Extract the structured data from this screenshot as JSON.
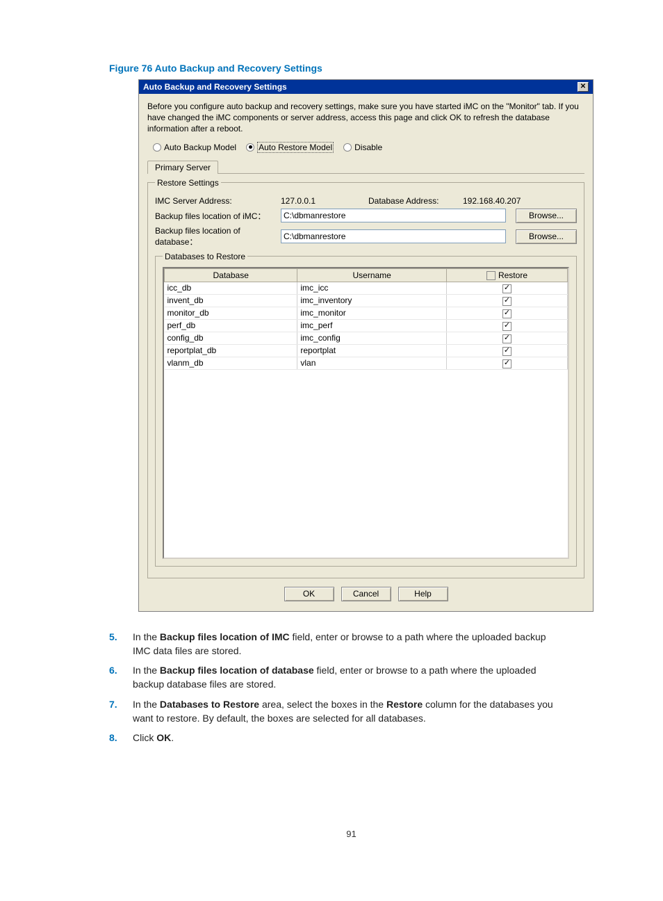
{
  "figure_caption": "Figure 76 Auto Backup and Recovery Settings",
  "dialog": {
    "title": "Auto Backup and Recovery Settings",
    "close_glyph": "✕",
    "intro": "Before you configure auto backup and recovery settings, make sure you have started iMC on the \"Monitor\" tab. If you have changed the iMC components or server address, access this page and click OK to refresh the database information after a reboot.",
    "radios": {
      "auto_backup": "Auto Backup Model",
      "auto_restore": "Auto Restore Model",
      "disable": "Disable"
    },
    "tab_primary": "Primary Server",
    "restore_legend": "Restore Settings",
    "labels": {
      "imc_addr": "IMC Server Address:",
      "db_addr": "Database Address:",
      "backup_imc": "Backup files location of iMC：",
      "backup_db": "Backup files location of database："
    },
    "values": {
      "imc_addr": "127.0.0.1",
      "db_addr": "192.168.40.207",
      "backup_imc": "C:\\dbmanrestore",
      "backup_db": "C:\\dbmanrestore"
    },
    "browse_label": "Browse...",
    "db_fieldset_legend": "Databases to Restore",
    "table": {
      "headers": {
        "database": "Database",
        "username": "Username",
        "restore": "Restore"
      },
      "rows": [
        {
          "database": "icc_db",
          "username": "imc_icc",
          "restore": true
        },
        {
          "database": "invent_db",
          "username": "imc_inventory",
          "restore": true
        },
        {
          "database": "monitor_db",
          "username": "imc_monitor",
          "restore": true
        },
        {
          "database": "perf_db",
          "username": "imc_perf",
          "restore": true
        },
        {
          "database": "config_db",
          "username": "imc_config",
          "restore": true
        },
        {
          "database": "reportplat_db",
          "username": "reportplat",
          "restore": true
        },
        {
          "database": "vlanm_db",
          "username": "vlan",
          "restore": true
        }
      ]
    },
    "buttons": {
      "ok": "OK",
      "cancel": "Cancel",
      "help": "Help"
    }
  },
  "steps": [
    {
      "num": "5.",
      "prefix": "In the ",
      "bold": "Backup files location of IMC",
      "suffix": " field, enter or browse to a path where the uploaded backup IMC data files are stored."
    },
    {
      "num": "6.",
      "prefix": "In the ",
      "bold": "Backup files location of database",
      "suffix": " field, enter or browse to a path where the uploaded backup database files are stored."
    },
    {
      "num": "7.",
      "prefix": "In the ",
      "bold": "Databases to Restore",
      "mid": " area, select the boxes in the ",
      "bold2": "Restore",
      "suffix": " column for the databases you want to restore. By default, the boxes are selected for all databases."
    },
    {
      "num": "8.",
      "prefix": "Click ",
      "bold": "OK",
      "suffix": "."
    }
  ],
  "page_number": "91"
}
